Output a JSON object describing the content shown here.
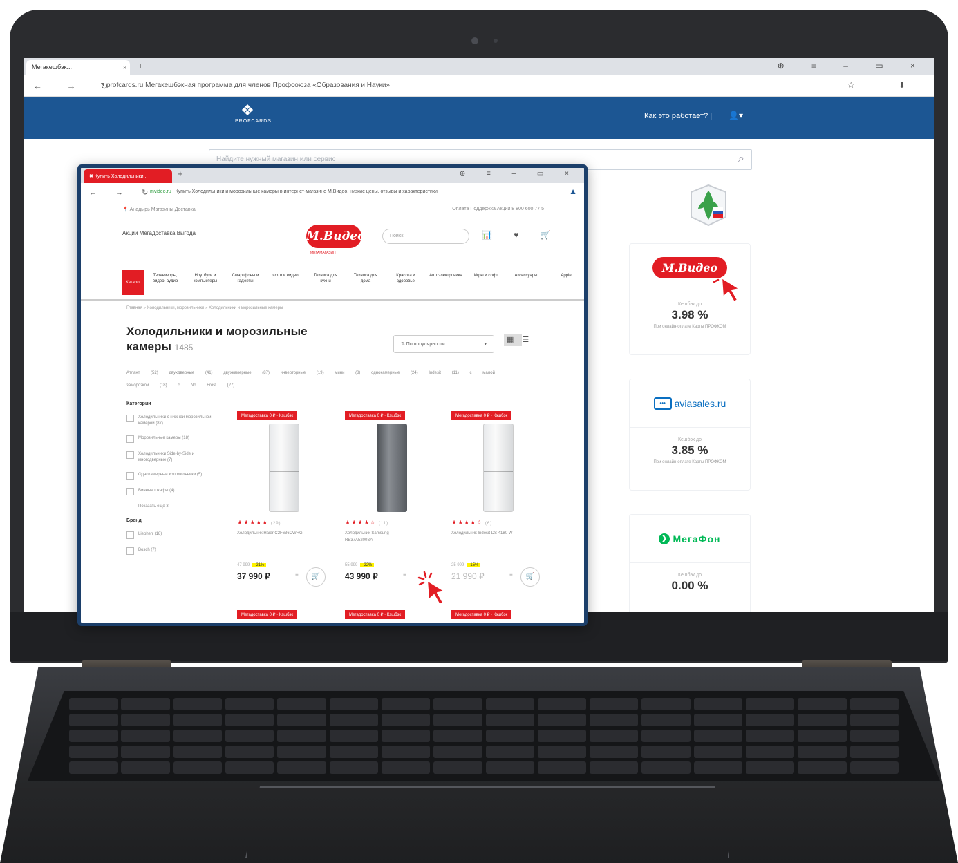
{
  "back_browser": {
    "tab_title": "Мегакешбэк...",
    "tab_close": "×",
    "new_tab": "+",
    "window_controls": "⊕ ≡ – ▭ ×",
    "nav": "← → ↻",
    "url": "profcards.ru  Мегакешбэкная программа для членов Профсоюза «Образования и Науки»",
    "url_right": "☆ ⬇",
    "logo_mark": "❖",
    "logo_text": "PROFCARDS",
    "how_it_works": "Как это работает? |",
    "user_icon": "👤▾",
    "search_placeholder": "Найдите нужный магазин или сервис",
    "search_icon": "⌕",
    "cards": [
      {
        "brand": "М.Видео",
        "caption": "Кешбэк до",
        "percent": "3.98 %",
        "note": "При онлайн-оплате Карты ПРОФКОМ"
      },
      {
        "brand": "aviasales.ru",
        "brand_box": "•••",
        "caption": "Кешбэк до",
        "percent": "3.85 %",
        "note": "При онлайн-оплате Карты ПРОФКОМ"
      },
      {
        "brand": "МегаФон",
        "caption": "Кешбэк до",
        "percent": "0.00 %",
        "note": ""
      }
    ]
  },
  "front_browser": {
    "tab_title": "✖ Купить Холодильники...",
    "new_tab": "+",
    "window_controls": "⊕ ≡ – ▭ ×",
    "nav": "← → ↻",
    "url_site": "mvideo.ru",
    "url_text": "Купить Холодильники и морозильные камеры в интернет-магазине М.Видео, низкие цены, отзывы и характеристики",
    "ext_icon": "▲",
    "top_city": "📍 Анадырь   Магазины   Доставка",
    "top_right": "Оплата   Поддержка   Акции   8 800 600 77 5",
    "top_menu": "Акции   Мегадоставка   Выгода",
    "logo": "М.Видео",
    "logo_sub": "МЕГАМАГАЗИН",
    "search_placeholder": "Поиск",
    "header_icons": "📊 ♥ 🛒",
    "catalog_btn": "Каталог",
    "categories": [
      "Телевизоры, видео, аудио",
      "Ноутбуки и компьютеры",
      "Смартфоны и гаджеты",
      "Фото и видео",
      "Техника для кухни",
      "Техника для дома",
      "Красота и здоровье",
      "Автоэлектроника",
      "Игры и софт",
      "Аксессуары",
      "Apple"
    ],
    "breadcrumbs": "Главная  »  Холодильники, морозильники  »  Холодильники и морозильные камеры",
    "title": "Холодильники и морозильные камеры",
    "title_count": "1485",
    "sort_label": "⇅ По популярности",
    "sort_arrow": "▾",
    "view_grid": "▦",
    "view_list": "☰",
    "chips": "Атлант (52)  двухдверные (41)  двухкамерные (87)  инверторные (19)  мини (8)  однокамерные (24)  Indesit (11)  с малой заморозкой (18)  с No Frost (27)",
    "sidebar_heading": "Категории",
    "sidebar_items": [
      "Холодильники с нижней морозильной камерой (87)",
      "Морозильные камеры (18)",
      "Холодильники Side-by-Side и многодверные (7)",
      "Однокамерные холодильники (5)",
      "Винные шкафы (4)",
      "Показать еще 3"
    ],
    "brand_heading": "Бренд",
    "brand_items": [
      "Liebherr (18)",
      "Bosch (7)"
    ],
    "badge": "Мегадоставка 0 ₽ · Кэшбэк",
    "products": [
      {
        "stars": "★★★★★",
        "reviews": "(29)",
        "name": "Холодильник Haier C2F636CWRG",
        "old": "47 999",
        "disc": "-21%",
        "price": "37 990 ₽",
        "cmp": "≡",
        "cart": "🛒"
      },
      {
        "stars": "★★★★☆",
        "reviews": "(11)",
        "name": "Холодильник Samsung RB37A5200SA",
        "old": "55 999",
        "disc": "-22%",
        "price": "43 990 ₽",
        "cmp": "≡",
        "cart": "🛒"
      },
      {
        "stars": "★★★★☆",
        "reviews": "(6)",
        "name": "Холодильник Indesit DS 4180 W",
        "old": "25 999",
        "disc": "-15%",
        "price": "21 990 ₽",
        "cmp": "≡",
        "cart": "🛒"
      }
    ]
  },
  "colors": {
    "brand_blue": "#1c5693",
    "mvideo_red": "#e21d24",
    "aviasales": "#0a6fc1",
    "megafon": "#00b956"
  }
}
